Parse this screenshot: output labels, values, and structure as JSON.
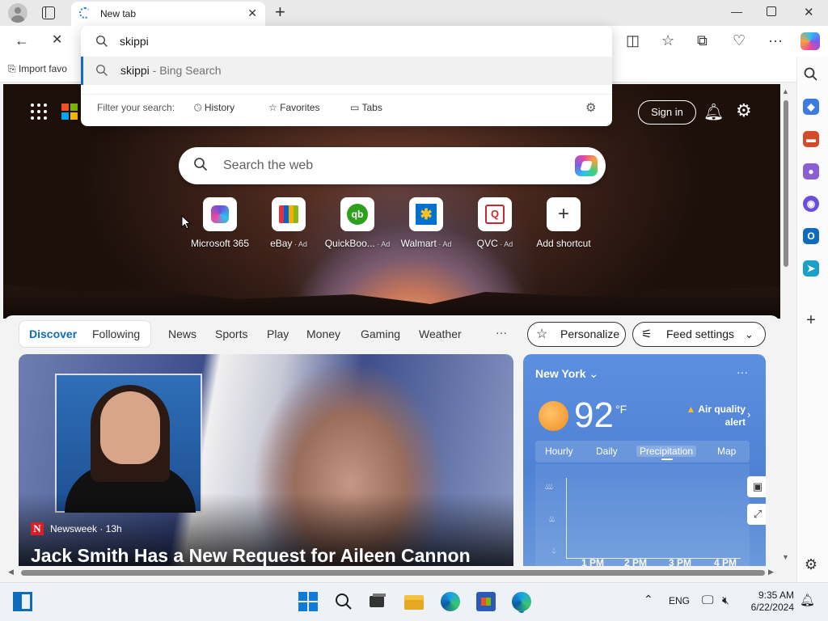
{
  "browser": {
    "tab_title": "New tab",
    "address_query": "skippi",
    "suggestion": {
      "term": "skippi",
      "sep": " - ",
      "engine": "Bing Search"
    },
    "filter_label": "Filter your search:",
    "filters": [
      "History",
      "Favorites",
      "Tabs"
    ],
    "favbar_text": "Import favo"
  },
  "hero": {
    "sign_in": "Sign in",
    "search_placeholder": "Search the web",
    "shortcuts": [
      {
        "name": "Microsoft 365",
        "ad": ""
      },
      {
        "name": "eBay",
        "ad": " · Ad"
      },
      {
        "name": "QuickBoo...",
        "ad": " · Ad"
      },
      {
        "name": "Walmart",
        "ad": " · Ad"
      },
      {
        "name": "QVC",
        "ad": " · Ad"
      },
      {
        "name": "Add shortcut",
        "ad": ""
      }
    ]
  },
  "feed": {
    "nav": [
      "Discover",
      "Following",
      "News",
      "Sports",
      "Play",
      "Money",
      "Gaming",
      "Weather"
    ],
    "more": "···",
    "personalize": "Personalize",
    "feed_settings": "Feed settings"
  },
  "story": {
    "source_initial": "N",
    "source": "Newsweek · 13h",
    "headline": "Jack Smith Has a New Request for Aileen Cannon"
  },
  "weather": {
    "city": "New York",
    "temp": "92",
    "unit": "°F",
    "alert_line1": "Air quality",
    "alert_line2": "alert",
    "tabs": [
      "Hourly",
      "Daily",
      "Precipitation",
      "Map"
    ],
    "times": [
      "1 PM",
      "2 PM",
      "3 PM",
      "4 PM"
    ],
    "more": "···"
  },
  "taskbar": {
    "lang": "ENG",
    "time": "9:35 AM",
    "date": "6/22/2024"
  },
  "colors": {
    "accent": "#0f6cbd",
    "weather_bg": "#5d8fe0",
    "newsweek_red": "#d42127"
  }
}
